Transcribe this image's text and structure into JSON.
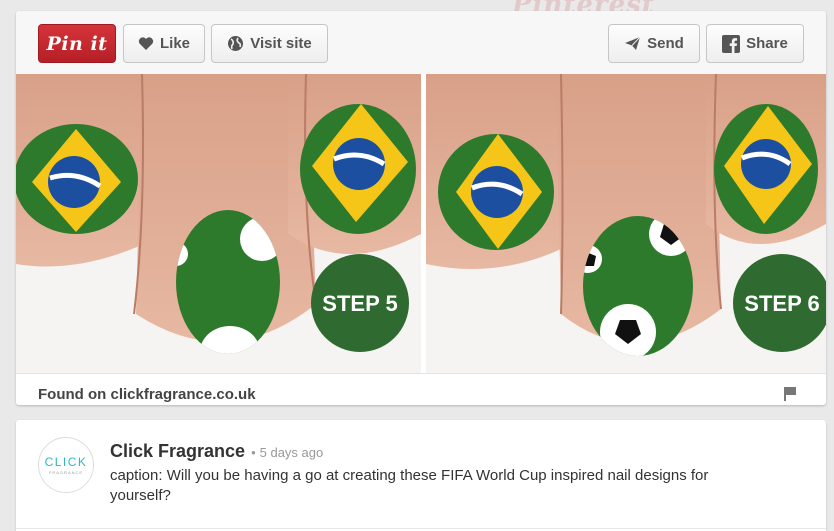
{
  "background": {
    "watermark": "Pinterest"
  },
  "toolbar": {
    "pin_it_label": "Pin it",
    "like_label": "Like",
    "visit_label": "Visit site",
    "send_label": "Send",
    "share_label": "Share"
  },
  "image": {
    "left_step": "STEP 5",
    "right_step": "STEP 6"
  },
  "source": {
    "found_on": "Found on clickfragrance.co.uk"
  },
  "comment": {
    "avatar_logo": "CLICK",
    "avatar_sub": "FRAGRANCE",
    "poster": "Click Fragrance",
    "separator": "•",
    "time": "5 days ago",
    "caption": "caption: Will you be having a go at creating these FIFA World Cup inspired nail designs for yourself?"
  },
  "colors": {
    "pin_red": "#c92228",
    "nail_green": "#2e7a2c",
    "flag_yellow": "#f5c518",
    "flag_blue": "#1d4fa0",
    "badge_green": "#2f6b30"
  },
  "icons": [
    "heart-icon",
    "globe-icon",
    "paper-plane-icon",
    "facebook-icon",
    "flag-icon"
  ]
}
